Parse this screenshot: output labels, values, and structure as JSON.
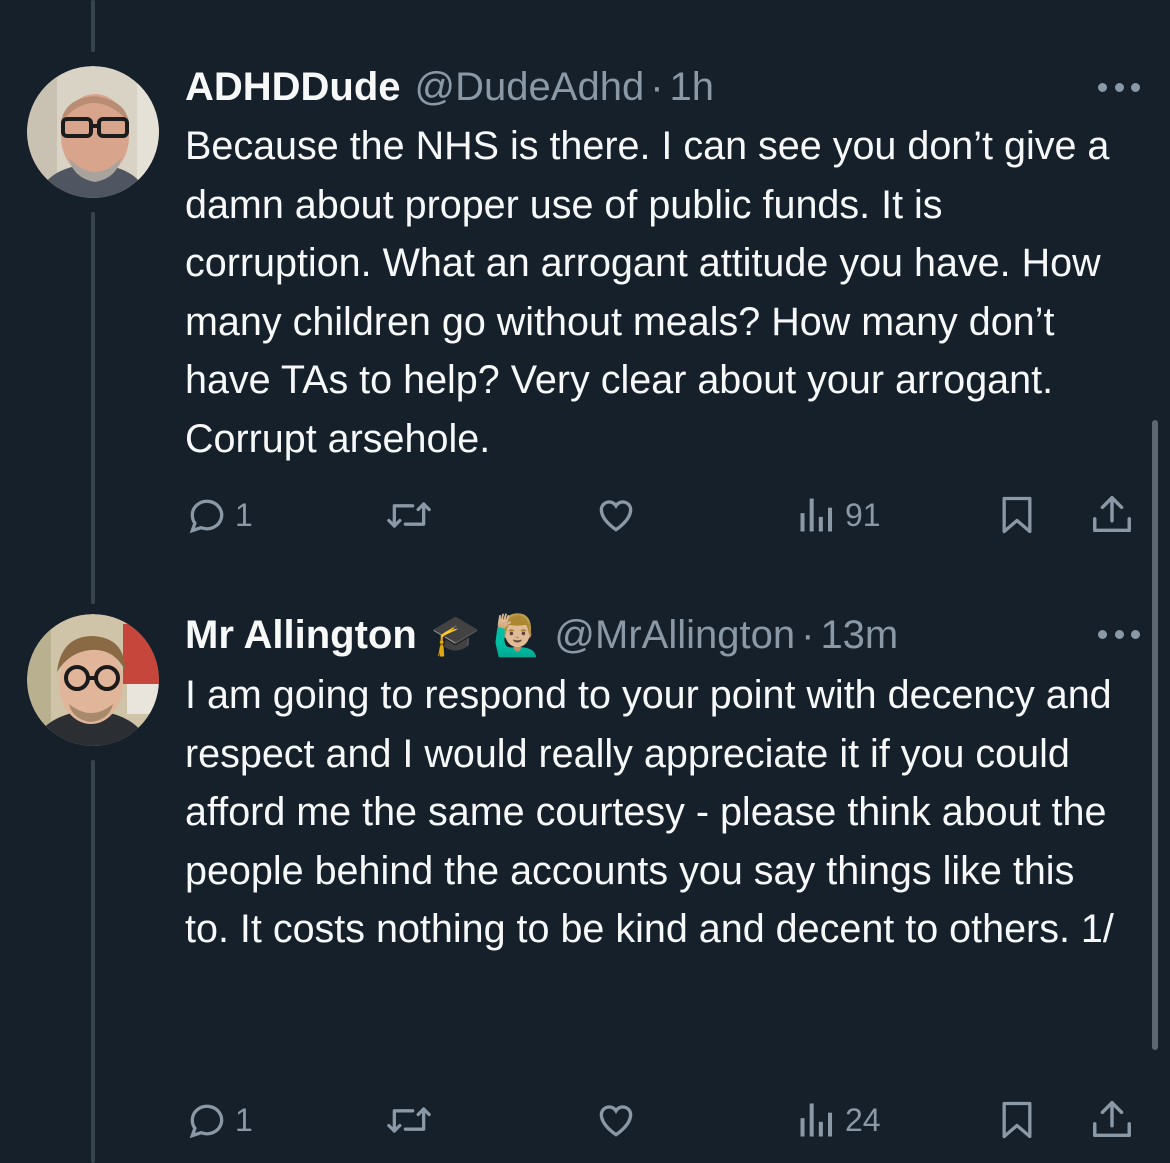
{
  "tweets": [
    {
      "display_name": "ADHDDude",
      "handle": "@DudeAdhd",
      "separator": "·",
      "time": "1h",
      "text": "Because the NHS is there. I can see you don’t give a damn about proper use of public funds. It is corruption. What an arrogant attitude you have. How many children go without meals? How many don’t have TAs to help? Very clear about your arrogant. Corrupt arsehole.",
      "reply_count": "1",
      "view_count": "91"
    },
    {
      "display_name": "Mr Allington",
      "name_emojis": [
        "🎓",
        "🙋🏼‍♂️"
      ],
      "handle": "@MrAllington",
      "separator": "·",
      "time": "13m",
      "text": "I am going to respond to your point with decency and respect and I would really appreciate it if you could afford me the same courtesy - please think about the people behind the accounts you say things like this to. It costs nothing to be kind and decent to others. 1/",
      "reply_count": "1",
      "view_count": "24"
    }
  ],
  "icons": [
    "reply-icon",
    "retweet-icon",
    "like-icon",
    "views-icon",
    "bookmark-icon",
    "share-icon",
    "more-icon"
  ],
  "colors": {
    "background": "#15202b",
    "text": "#f7f9f9",
    "muted": "#8b98a5",
    "thread_line": "#38444d"
  }
}
